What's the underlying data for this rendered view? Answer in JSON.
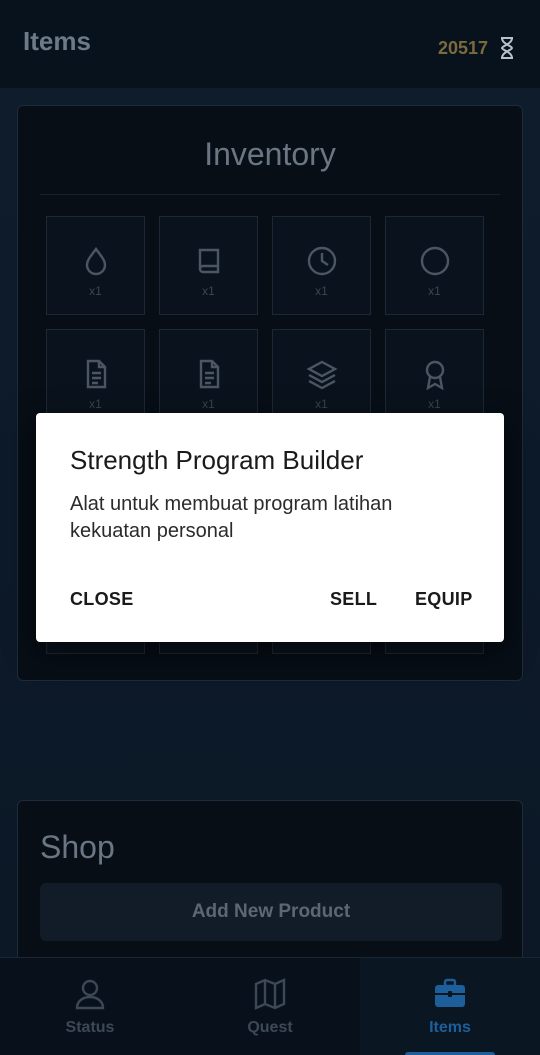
{
  "header": {
    "title": "Items",
    "currency_value": "20517",
    "currency_icon": "hourglass-icon"
  },
  "inventory": {
    "title": "Inventory",
    "slots": [
      {
        "icon": "droplet-icon",
        "count": "x1"
      },
      {
        "icon": "book-icon",
        "count": "x1"
      },
      {
        "icon": "clock-icon",
        "count": "x1"
      },
      {
        "icon": "circle-icon",
        "count": "x1"
      },
      {
        "icon": "document-icon",
        "count": "x1"
      },
      {
        "icon": "document-icon",
        "count": "x1"
      },
      {
        "icon": "layers-icon",
        "count": "x1"
      },
      {
        "icon": "award-icon",
        "count": "x1"
      }
    ]
  },
  "shop": {
    "title": "Shop",
    "add_button_label": "Add New Product"
  },
  "nav": {
    "items": [
      {
        "label": "Status",
        "icon": "user-icon"
      },
      {
        "label": "Quest",
        "icon": "map-icon"
      },
      {
        "label": "Items",
        "icon": "briefcase-icon"
      }
    ],
    "active": "Items"
  },
  "dialog": {
    "title": "Strength Program Builder",
    "description": "Alat untuk membuat program latihan kekuatan personal",
    "close_label": "CLOSE",
    "sell_label": "SELL",
    "equip_label": "EQUIP"
  },
  "colors": {
    "background": "#0d1a2a",
    "accent": "#1d5f9a",
    "currency": "#7a6a3c",
    "dialog_bg": "#ffffff"
  }
}
